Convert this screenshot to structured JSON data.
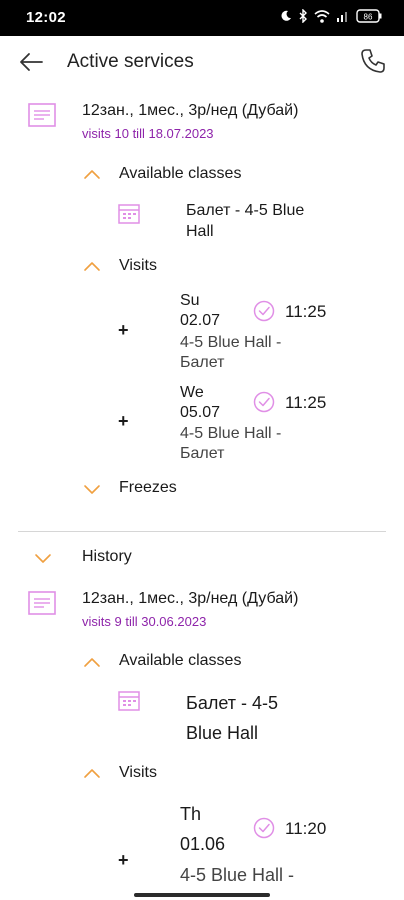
{
  "status_bar": {
    "time": "12:02",
    "battery": "86"
  },
  "header": {
    "title": "Active services"
  },
  "active_service": {
    "title": "12зан., 1мес., 3р/нед (Дубай)",
    "subtitle": "visits 10 till 18.07.2023",
    "available_classes_label": "Available classes",
    "classes": [
      {
        "name_line1": "Балет - 4-5 Blue",
        "name_line2": "Hall"
      }
    ],
    "visits_label": "Visits",
    "visits": [
      {
        "day": "Su",
        "date": "02.07",
        "time": "11:25",
        "place_line1": "4-5 Blue Hall -",
        "place_line2": "Балет",
        "add": "+"
      },
      {
        "day": "We",
        "date": "05.07",
        "time": "11:25",
        "place_line1": "4-5 Blue Hall -",
        "place_line2": "Балет",
        "add": "+"
      }
    ],
    "freezes_label": "Freezes"
  },
  "history": {
    "label": "History",
    "services": [
      {
        "title": "12зан., 1мес., 3р/нед (Дубай)",
        "subtitle": "visits 9 till 30.06.2023",
        "available_classes_label": "Available classes",
        "classes": [
          {
            "name_line1": "Балет - 4-5",
            "name_line2": "Blue Hall"
          }
        ],
        "visits_label": "Visits",
        "visits": [
          {
            "day": "Th",
            "date": "01.06",
            "time": "11:20",
            "place_line1": "4-5 Blue Hall -",
            "add": "+"
          }
        ]
      }
    ]
  },
  "colors": {
    "accent_purple": "#8e24aa",
    "icon_pink": "#e08fe6",
    "chevron_orange": "#f0a040",
    "divider": "#d6d6d6"
  },
  "icons": {
    "back": "arrow-left-icon",
    "phone": "phone-icon",
    "service": "document-icon",
    "class": "calendar-icon",
    "visit_status": "check-circle-icon",
    "expand": "chevron-icon"
  }
}
